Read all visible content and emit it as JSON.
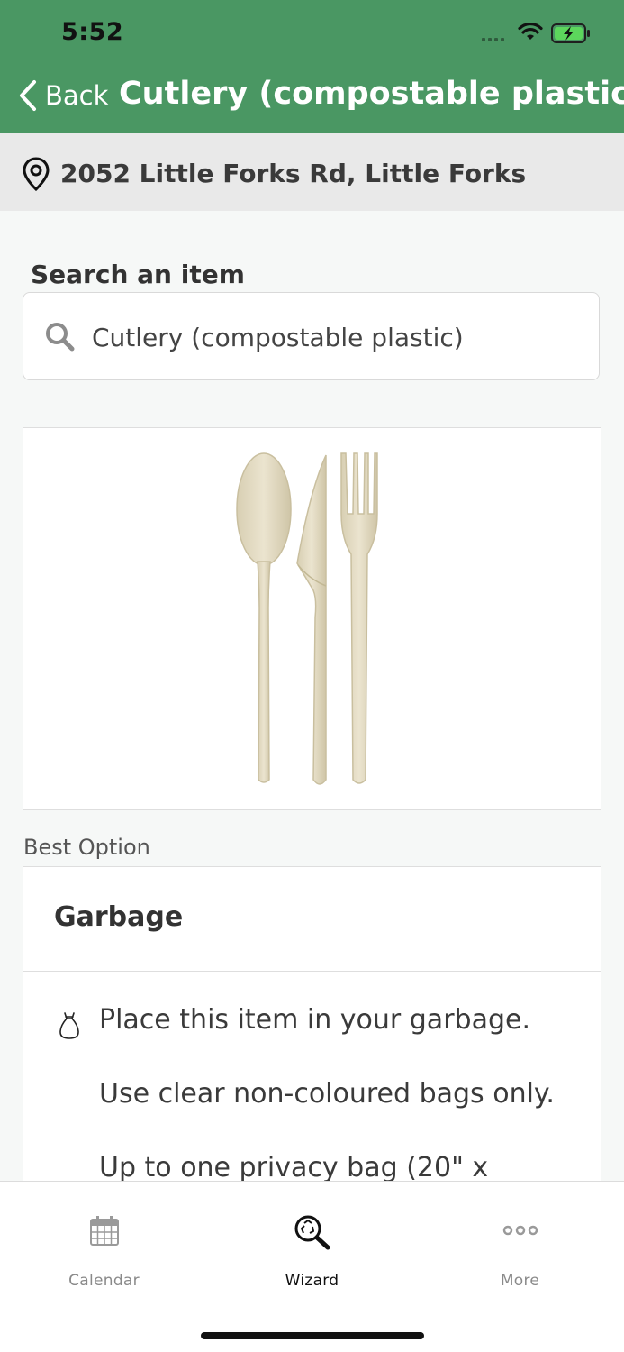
{
  "status_bar": {
    "time": "5:52"
  },
  "nav": {
    "back_label": "Back",
    "title": "Cutlery (compostable plastic)"
  },
  "location": {
    "address": "2052 Little Forks Rd, Little Forks"
  },
  "search": {
    "label": "Search an item",
    "value": "Cutlery (compostable plastic)"
  },
  "item_image": {
    "alt": "Compostable spoon, knife and fork"
  },
  "best_option": {
    "section_label": "Best Option",
    "title": "Garbage",
    "instructions": [
      "Place this item in your garbage.",
      "Use clear non-coloured bags only.",
      "Up to one privacy bag (20\" x"
    ]
  },
  "tabs": [
    {
      "label": "Calendar",
      "icon": "calendar-icon",
      "active": false
    },
    {
      "label": "Wizard",
      "icon": "recycle-search-icon",
      "active": true
    },
    {
      "label": "More",
      "icon": "more-icon",
      "active": false
    }
  ],
  "colors": {
    "header_green": "#4a9763",
    "active_tab": "#111111",
    "inactive_tab": "#8a8a8a"
  }
}
